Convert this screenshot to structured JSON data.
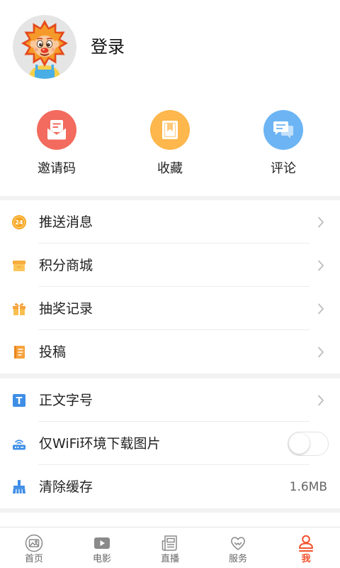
{
  "profile": {
    "login_label": "登录",
    "avatar_icon": "lion-mascot-avatar"
  },
  "quick_actions": [
    {
      "label": "邀请码",
      "icon": "invite-mail-icon",
      "color": "#F26B5E"
    },
    {
      "label": "收藏",
      "icon": "favorites-icon",
      "color": "#FDB74C"
    },
    {
      "label": "评论",
      "icon": "comments-icon",
      "color": "#6CB4F4"
    }
  ],
  "menu_group_1": [
    {
      "label": "推送消息",
      "icon": "push-notification-icon",
      "icon_text": "24",
      "trailing": "chevron-right-icon"
    },
    {
      "label": "积分商城",
      "icon": "points-mall-icon",
      "trailing": "chevron-right-icon"
    },
    {
      "label": "抽奖记录",
      "icon": "lottery-gift-icon",
      "trailing": "chevron-right-icon"
    },
    {
      "label": "投稿",
      "icon": "submission-doc-icon",
      "trailing": "chevron-right-icon"
    }
  ],
  "menu_group_2": [
    {
      "label": "正文字号",
      "icon": "font-size-icon",
      "icon_text": "T",
      "trailing": "chevron-right-icon"
    },
    {
      "label": "仅WiFi环境下载图片",
      "icon": "wifi-router-icon",
      "toggle_on": false
    },
    {
      "label": "清除缓存",
      "icon": "clear-cache-broom-icon",
      "value": "1.6MB"
    }
  ],
  "tab_bar": {
    "items": [
      {
        "label": "首页",
        "icon": "home-picture-icon"
      },
      {
        "label": "电影",
        "icon": "movie-play-icon"
      },
      {
        "label": "直播",
        "icon": "live-newspaper-icon"
      },
      {
        "label": "服务",
        "icon": "service-heart-icon"
      },
      {
        "label": "我",
        "icon": "me-person-icon"
      }
    ],
    "active_index": 4
  },
  "colors": {
    "accent": "#F2522E",
    "section_gap": "#F2F2F2",
    "divider": "#ECECEC",
    "chevron": "#BDBDBD",
    "tab_inactive": "#8A8A8A",
    "list_icon_orange": "#F7A23B",
    "list_icon_blue": "#3E8EE6"
  }
}
